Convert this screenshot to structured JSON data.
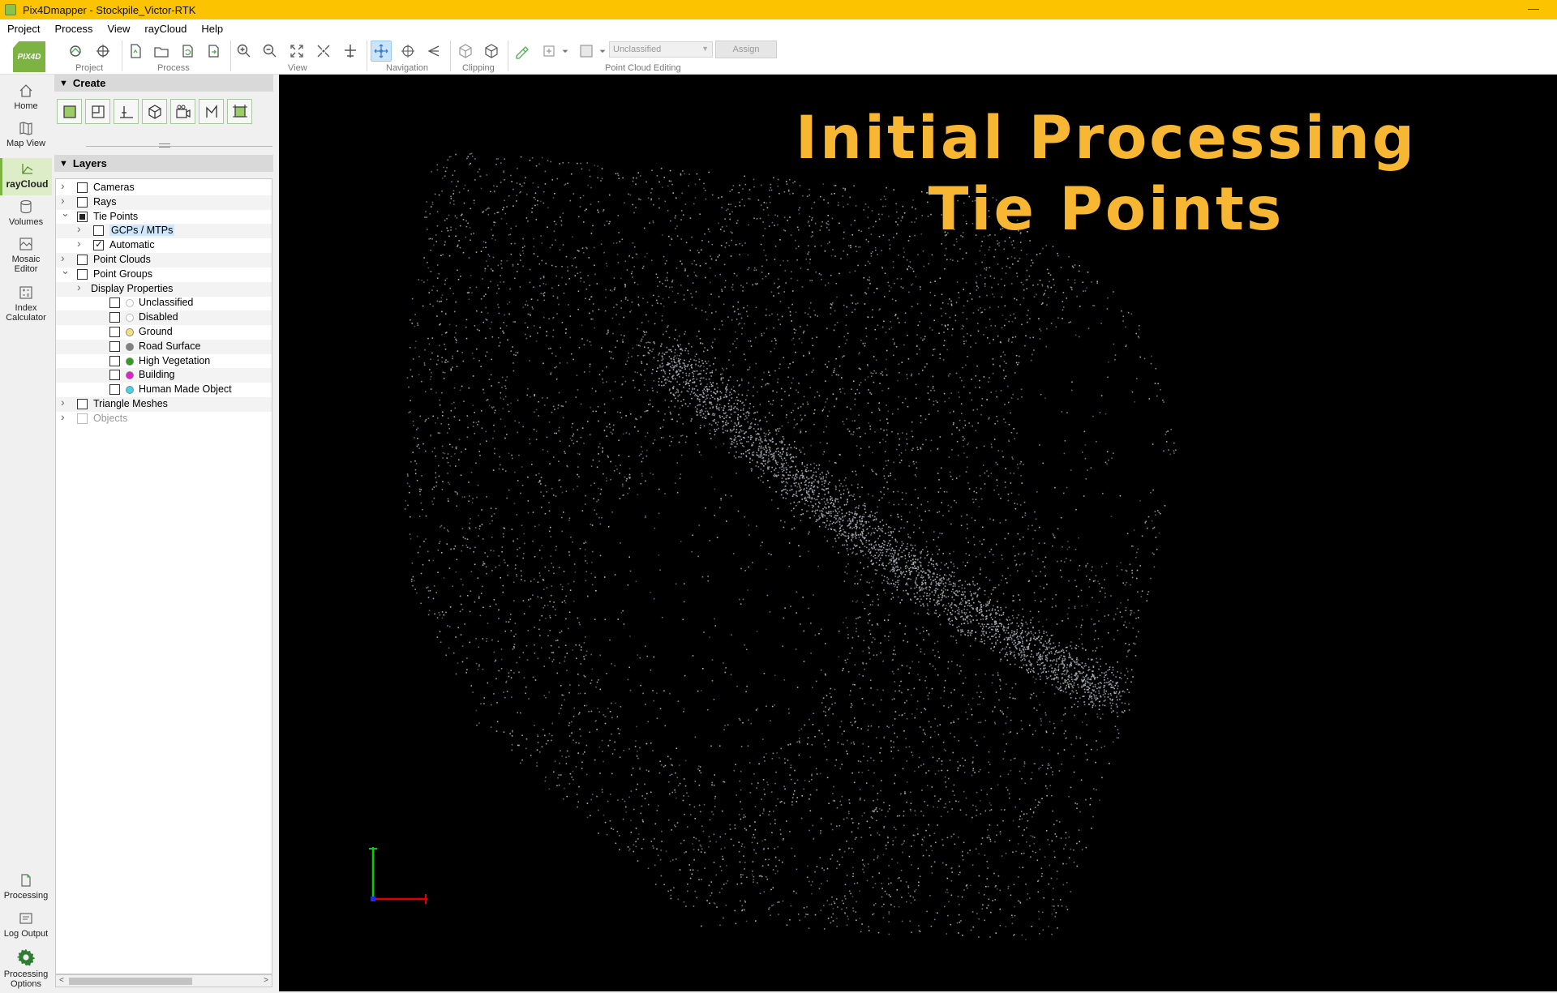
{
  "window": {
    "title": "Pix4Dmapper - Stockpile_Victor-RTK",
    "minimize_glyph": "—"
  },
  "menu": [
    "Project",
    "Process",
    "View",
    "rayCloud",
    "Help"
  ],
  "logo_text": "PIX4D",
  "toolbar": {
    "groups": [
      "Project",
      "Process",
      "View",
      "Navigation",
      "Clipping",
      "Point Cloud Editing"
    ],
    "classification_select": "Unclassified",
    "assign_label": "Assign"
  },
  "leftnav": {
    "items": [
      {
        "label": "Home",
        "icon": "home-icon"
      },
      {
        "label": "Map View",
        "icon": "map-icon"
      },
      {
        "label": "rayCloud",
        "icon": "raycloud-icon",
        "active": true
      },
      {
        "label": "Volumes",
        "icon": "volumes-icon"
      },
      {
        "label": "Mosaic Editor",
        "icon": "mosaic-editor-icon"
      },
      {
        "label": "Index Calculator",
        "icon": "index-calculator-icon"
      }
    ],
    "bottom_items": [
      {
        "label": "Processing",
        "icon": "processing-icon"
      },
      {
        "label": "Log Output",
        "icon": "log-output-icon"
      },
      {
        "label": "Processing Options",
        "icon": "gear-icon"
      }
    ]
  },
  "panel": {
    "create_title": "Create",
    "layers_title": "Layers",
    "tree": [
      {
        "label": "Cameras",
        "level": 0,
        "expand": "collapsed",
        "check": "unchecked"
      },
      {
        "label": "Rays",
        "level": 0,
        "expand": "collapsed",
        "check": "unchecked"
      },
      {
        "label": "Tie Points",
        "level": 0,
        "expand": "expanded",
        "check": "partial"
      },
      {
        "label": "GCPs / MTPs",
        "level": 1,
        "expand": "collapsed",
        "check": "unchecked",
        "highlight": true
      },
      {
        "label": "Automatic",
        "level": 1,
        "expand": "collapsed",
        "check": "checked"
      },
      {
        "label": "Point Clouds",
        "level": 0,
        "expand": "collapsed",
        "check": "unchecked"
      },
      {
        "label": "Point Groups",
        "level": 0,
        "expand": "expanded",
        "check": "unchecked"
      },
      {
        "label": "Display Properties",
        "level": 1,
        "expand": "collapsed",
        "check": "none"
      },
      {
        "label": "Unclassified",
        "level": 2,
        "check": "unchecked",
        "dot": "#ffffff"
      },
      {
        "label": "Disabled",
        "level": 2,
        "check": "unchecked",
        "dot": "#ffffff"
      },
      {
        "label": "Ground",
        "level": 2,
        "check": "unchecked",
        "dot": "#f3e27a"
      },
      {
        "label": "Road Surface",
        "level": 2,
        "check": "unchecked",
        "dot": "#808080"
      },
      {
        "label": "High Vegetation",
        "level": 2,
        "check": "unchecked",
        "dot": "#2e9e1f"
      },
      {
        "label": "Building",
        "level": 2,
        "check": "unchecked",
        "dot": "#e020d0"
      },
      {
        "label": "Human Made Object",
        "level": 2,
        "check": "unchecked",
        "dot": "#3fd6e6"
      },
      {
        "label": "Triangle Meshes",
        "level": 0,
        "expand": "collapsed",
        "check": "unchecked"
      },
      {
        "label": "Objects",
        "level": 0,
        "expand": "collapsed",
        "check": "disabled",
        "dim": true
      }
    ]
  },
  "viewport": {
    "overlay_line1": "Initial Processing",
    "overlay_line2": "Tie Points",
    "overlay_color": "#f7b733"
  },
  "colors": {
    "titlebar": "#fcc400",
    "accent_green": "#7cb342",
    "axis_x": "#e00000",
    "axis_y": "#00d000"
  }
}
